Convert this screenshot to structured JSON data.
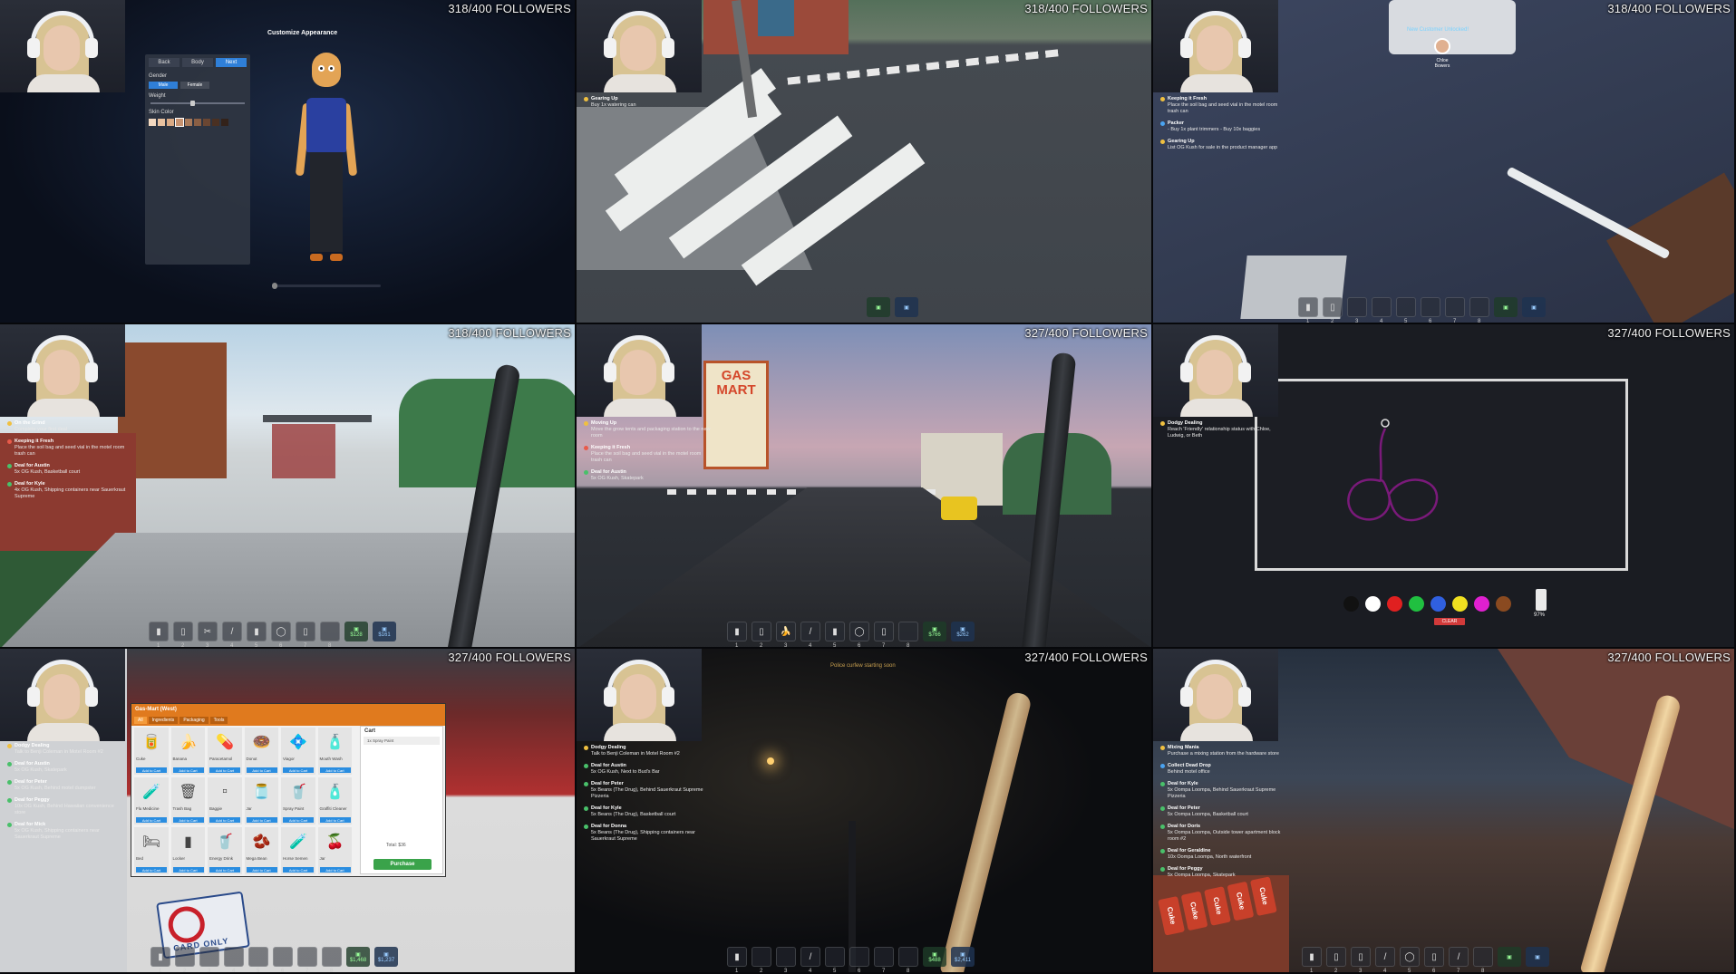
{
  "followers": [
    "318/400 FOLLOWERS",
    "318/400 FOLLOWERS",
    "318/400 FOLLOWERS",
    "318/400 FOLLOWERS",
    "327/400 FOLLOWERS",
    "327/400 FOLLOWERS",
    "327/400 FOLLOWERS",
    "327/400 FOLLOWERS",
    "327/400 FOLLOWERS"
  ],
  "customize": {
    "title": "Customize Appearance",
    "tabs": [
      "Back",
      "Body",
      "Next"
    ],
    "gender_label": "Gender",
    "gender_options": [
      "Male",
      "Female"
    ],
    "weight_label": "Weight",
    "skin_label": "Skin Color",
    "skin_colors": [
      "#f3d9c0",
      "#e9c2a0",
      "#d9aa85",
      "#c69270",
      "#a97a5a",
      "#8a5f44",
      "#6a4632",
      "#4a3022",
      "#33221a"
    ]
  },
  "tile2": {
    "tasks": [
      {
        "title": "Gearing Up",
        "text": "Buy 1x watering can"
      }
    ]
  },
  "tile3": {
    "unlock_text": "New Customer Unlocked!",
    "customer_name": "Chloe Bowers",
    "tasks": [
      {
        "title": "Keeping it Fresh",
        "text": "Place the soil bag and seed vial in the motel room trash can"
      },
      {
        "title": "Packer",
        "text": "- Buy 1x plant trimmers - Buy 10x baggies"
      },
      {
        "title": "Gearing Up",
        "text": "List OG Kush for sale in the product manager app"
      }
    ]
  },
  "tile4": {
    "tasks": [
      {
        "title": "On the Grind",
        "text": "Complete your first deal"
      },
      {
        "title": "Keeping it Fresh",
        "text": "Place the soil bag and seed vial in the motel room trash can"
      },
      {
        "title": "Deal for Austin",
        "text": "5x OG Kush, Basketball court"
      },
      {
        "title": "Deal for Kyle",
        "text": "4x OG Kush, Shipping containers near Sauerkraut Supreme"
      }
    ]
  },
  "tile5": {
    "sign": "GAS MART",
    "tasks": [
      {
        "title": "Moving Up",
        "text": "Move the grow tents and packaging station to the new room"
      },
      {
        "title": "Keeping it Fresh",
        "text": "Place the soil bag and seed vial in the motel room trash can"
      },
      {
        "title": "Deal for Austin",
        "text": "5x OG Kush, Skatepark"
      }
    ]
  },
  "tile6": {
    "tasks": [
      {
        "title": "Dodgy Dealing",
        "text": "Reach 'Friendly' relationship status with Chloe, Ludwig, or Beth"
      }
    ],
    "paint_colors": [
      "#111111",
      "#ffffff",
      "#e02020",
      "#20c040",
      "#3060e0",
      "#f0e020",
      "#e020d0",
      "#8a4a20"
    ],
    "clear_label": "CLEAR",
    "spray_pct": "97%"
  },
  "shop": {
    "title": "Gas-Mart (West)",
    "tabs": [
      "All",
      "Ingredients",
      "Packaging",
      "Tools"
    ],
    "items": [
      {
        "name": "Cuke",
        "icon": "🥫"
      },
      {
        "name": "Banana",
        "icon": "🍌"
      },
      {
        "name": "Paracetamol",
        "icon": "💊"
      },
      {
        "name": "Donut",
        "icon": "🍩"
      },
      {
        "name": "Viagor",
        "icon": "💠"
      },
      {
        "name": "Mouth Wash",
        "icon": "🧴"
      },
      {
        "name": "Flu Medicine",
        "icon": "🧪"
      },
      {
        "name": "Trash Bag",
        "icon": "🗑"
      },
      {
        "name": "Baggie",
        "icon": "▫"
      },
      {
        "name": "Jar",
        "icon": "🫙"
      },
      {
        "name": "Spray Paint",
        "icon": "🥤"
      },
      {
        "name": "Graffiti Cleaner",
        "icon": "🧴"
      },
      {
        "name": "Bed",
        "icon": "🛏"
      },
      {
        "name": "Locker",
        "icon": "▮"
      },
      {
        "name": "Energy Drink",
        "icon": "🥤"
      },
      {
        "name": "Mega Bean",
        "icon": "🫘"
      },
      {
        "name": "Horse Semen",
        "icon": "🧪"
      },
      {
        "name": "Jar",
        "icon": "🍒"
      }
    ],
    "add_label": "Add to Cart",
    "cart_title": "Cart",
    "cart_lines": [
      "1x Spray Paint"
    ],
    "total_label": "Total: $36",
    "purchase_label": "Purchase",
    "nocard_label": "CARD ONLY",
    "tasks": [
      {
        "title": "Dodgy Dealing",
        "text": "Talk to Benji Coleman in Motel Room #2"
      },
      {
        "title": "Deal for Austin",
        "text": "5x OG Kush, Skatepark"
      },
      {
        "title": "Deal for Peter",
        "text": "5x OG Kush, Behind motel dumpster"
      },
      {
        "title": "Deal for Peggy",
        "text": "10x OG Kush, Behind Hawaiian convenience store"
      },
      {
        "title": "Deal for Mick",
        "text": "5x OG Kush, Shipping containers near Sauerkraut Supreme"
      }
    ]
  },
  "tile8": {
    "curfew": "Police curfew starting soon",
    "tasks": [
      {
        "title": "Dodgy Dealing",
        "text": "Talk to Benji Coleman in Motel Room #2"
      },
      {
        "title": "Deal for Austin",
        "text": "5x OG Kush, Next to Bud's Bar"
      },
      {
        "title": "Deal for Peter",
        "text": "5x Beans (The Drug), Behind Sauerkraut Supreme Pizzeria"
      },
      {
        "title": "Deal for Kyle",
        "text": "5x Beans (The Drug), Basketball court"
      },
      {
        "title": "Deal for Donna",
        "text": "5x Beans (The Drug), Shipping containers near Sauerkraut Supreme"
      }
    ]
  },
  "tile9": {
    "tasks": [
      {
        "title": "Mixing Mania",
        "text": "Purchase a mixing station from the hardware store"
      },
      {
        "title": "Collect Dead Drop",
        "text": "Behind motel office"
      },
      {
        "title": "Deal for Kyle",
        "text": "5x Oompa Loompa, Behind Sauerkraut Supreme Pizzeria"
      },
      {
        "title": "Deal for Peter",
        "text": "5x Oompa Loompa, Basketball court"
      },
      {
        "title": "Deal for Doris",
        "text": "5x Oompa Loompa, Outside tower apartment block room #2"
      },
      {
        "title": "Deal for Geraldine",
        "text": "10x Oompa Loompa, North waterfront"
      },
      {
        "title": "Deal for Peggy",
        "text": "5x Oompa Loompa, Skatepark"
      }
    ],
    "cans": [
      "Cuke",
      "Cuke",
      "Cuke",
      "Cuke",
      "Cuke"
    ]
  },
  "hotbar": {
    "money": [
      "$128",
      "$766",
      "$1,468",
      "$488"
    ],
    "bank": [
      "$161",
      "$262",
      "$1,237",
      "$2,411"
    ]
  }
}
